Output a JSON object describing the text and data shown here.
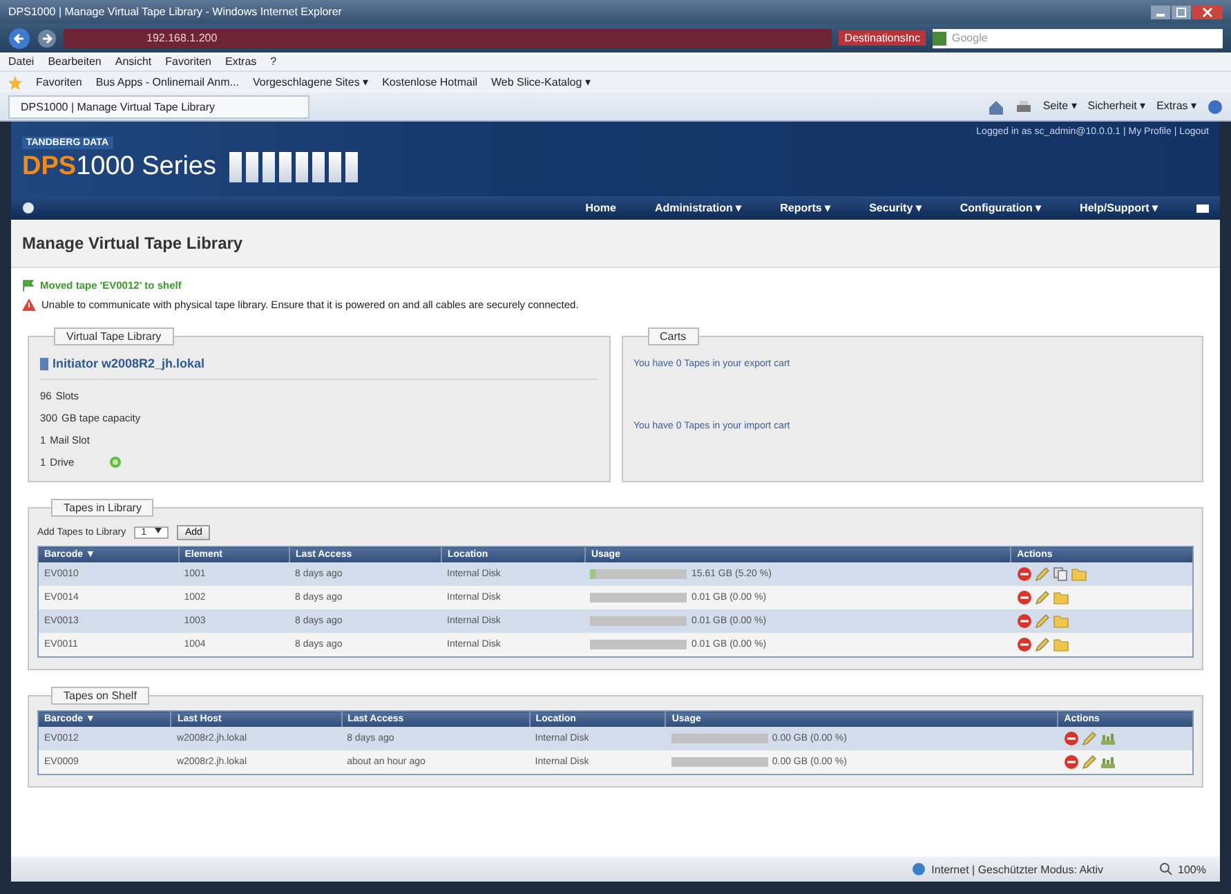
{
  "browser": {
    "title": "DPS1000 | Manage Virtual Tape Library - Windows Internet Explorer",
    "address": "192.168.1.200",
    "search_provider": "DestinationsInc",
    "search_placeholder": "Google",
    "menu": [
      "Datei",
      "Bearbeiten",
      "Ansicht",
      "Favoriten",
      "Extras",
      "?"
    ],
    "favorites": [
      {
        "label": "Favoriten"
      },
      {
        "label": "Bus Apps - Onlinemail Anm..."
      },
      {
        "label": "Vorgeschlagene Sites ▾"
      },
      {
        "label": "Kostenlose Hotmail"
      },
      {
        "label": "Web Slice-Katalog ▾"
      }
    ],
    "tab": "DPS1000 | Manage Virtual Tape Library",
    "commands": [
      "Seite ▾",
      "Sicherheit ▾",
      "Extras ▾"
    ]
  },
  "header": {
    "brand": "TANDBERG DATA",
    "product_bold": "DPS",
    "product": "1000 Series",
    "user_links": "Logged in as sc_admin@10.0.0.1 | My Profile | Logout"
  },
  "nav": [
    "Home",
    "Administration ▾",
    "Reports ▾",
    "Security ▾",
    "Configuration ▾",
    "Help/Support ▾"
  ],
  "page_title": "Manage Virtual Tape Library",
  "messages": [
    {
      "kind": "success",
      "text": "Moved tape 'EV0012' to shelf"
    },
    {
      "kind": "error",
      "text": "Unable to communicate with physical tape library. Ensure that it is powered on and all cables are securely connected."
    }
  ],
  "library_panel": {
    "legend": "Virtual Tape Library",
    "initiator": "Initiator w2008R2_jh.lokal",
    "facts": [
      {
        "value": "96",
        "label": "Slots",
        "ok": false
      },
      {
        "value": "300",
        "label": "GB tape capacity",
        "ok": false
      },
      {
        "value": "1",
        "label": "Mail Slot",
        "ok": false
      },
      {
        "value": "1",
        "label": "Drive",
        "ok": true
      }
    ]
  },
  "carts_panel": {
    "legend": "Carts",
    "lines": [
      "You have 0 Tapes in your export cart",
      "You have 0 Tapes in your import cart"
    ]
  },
  "tapes_in_library": {
    "legend": "Tapes in Library",
    "add_label": "Add Tapes to Library",
    "add_count": "1",
    "add_button": "Add",
    "columns": [
      "Barcode ▼",
      "Element",
      "Last Access",
      "Location",
      "Usage",
      "Actions"
    ],
    "rows": [
      {
        "cells": [
          "EV0010",
          "1001",
          "8 days ago",
          "Internal Disk"
        ],
        "level": 0.052,
        "usage": "15.61 GB (5.20 %)",
        "actions": [
          {
            "kind": "delete"
          },
          {
            "kind": "edit"
          },
          {
            "kind": "copy"
          },
          {
            "kind": "folder"
          }
        ]
      },
      {
        "cells": [
          "EV0014",
          "1002",
          "8 days ago",
          "Internal Disk"
        ],
        "level": 0,
        "usage": "0.01 GB (0.00 %)",
        "actions": [
          {
            "kind": "delete"
          },
          {
            "kind": "edit"
          },
          {
            "kind": "folder"
          }
        ]
      },
      {
        "cells": [
          "EV0013",
          "1003",
          "8 days ago",
          "Internal Disk"
        ],
        "level": 0,
        "usage": "0.01 GB (0.00 %)",
        "actions": [
          {
            "kind": "delete"
          },
          {
            "kind": "edit"
          },
          {
            "kind": "folder"
          }
        ]
      },
      {
        "cells": [
          "EV0011",
          "1004",
          "8 days ago",
          "Internal Disk"
        ],
        "level": 0,
        "usage": "0.01 GB (0.00 %)",
        "actions": [
          {
            "kind": "delete"
          },
          {
            "kind": "edit"
          },
          {
            "kind": "folder"
          }
        ]
      }
    ]
  },
  "tapes_on_shelf": {
    "legend": "Tapes on Shelf",
    "columns": [
      "Barcode ▼",
      "Last Host",
      "Last Access",
      "Location",
      "Usage",
      "Actions"
    ],
    "rows": [
      {
        "cells": [
          "EV0012",
          "w2008r2.jh.lokal",
          "8 days ago",
          "Internal Disk"
        ],
        "level": 0,
        "usage": "0.00 GB (0.00 %)",
        "actions": [
          {
            "kind": "delete"
          },
          {
            "kind": "edit"
          },
          {
            "kind": "shelf"
          }
        ]
      },
      {
        "cells": [
          "EV0009",
          "w2008r2.jh.lokal",
          "about an hour ago",
          "Internal Disk"
        ],
        "level": 0,
        "usage": "0.00 GB (0.00 %)",
        "actions": [
          {
            "kind": "delete"
          },
          {
            "kind": "edit"
          },
          {
            "kind": "shelf"
          }
        ]
      }
    ]
  },
  "status_bar": {
    "zone": "Internet | Geschützter Modus: Aktiv",
    "zoom": "100%"
  }
}
